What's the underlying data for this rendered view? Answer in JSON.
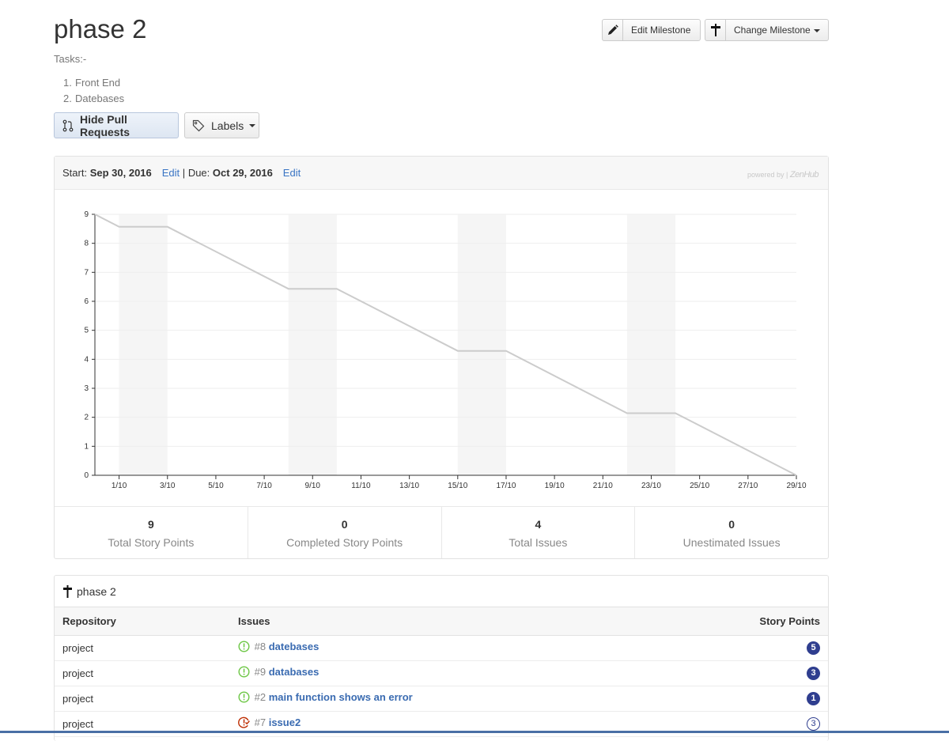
{
  "milestone": {
    "title": "phase 2",
    "tasks_label": "Tasks:-",
    "tasks": [
      {
        "num": "1.",
        "text": "Front End"
      },
      {
        "num": "2.",
        "text": "Datebases"
      }
    ]
  },
  "toolbar": {
    "edit_milestone": "Edit Milestone",
    "change_milestone": "Change Milestone",
    "hide_pull_requests": "Hide Pull Requests",
    "labels": "Labels"
  },
  "burndown": {
    "start_label": "Start:",
    "start_date": "Sep 30, 2016",
    "edit_start": "Edit",
    "separator": "|",
    "due_label": "Due:",
    "due_date": "Oct 29, 2016",
    "edit_due": "Edit",
    "powered_by": "powered by |",
    "powered_brand": "ZenHub"
  },
  "chart_data": {
    "type": "line",
    "x_start": "2016-09-30",
    "x_end": "2016-10-29",
    "x_tick_labels": [
      "1/10",
      "3/10",
      "5/10",
      "7/10",
      "9/10",
      "11/10",
      "13/10",
      "15/10",
      "17/10",
      "19/10",
      "21/10",
      "23/10",
      "25/10",
      "27/10",
      "29/10"
    ],
    "ylim": [
      0,
      9
    ],
    "y_ticks": [
      0,
      1,
      2,
      3,
      4,
      5,
      6,
      7,
      8,
      9
    ],
    "grid": true,
    "weekend_shading": [
      [
        "2016-10-01",
        "2016-10-03"
      ],
      [
        "2016-10-08",
        "2016-10-10"
      ],
      [
        "2016-10-15",
        "2016-10-17"
      ],
      [
        "2016-10-22",
        "2016-10-24"
      ],
      [
        "2016-10-29",
        "2016-10-30"
      ]
    ],
    "series": [
      {
        "color": "#cccccc",
        "points": [
          {
            "x": "2016-09-30",
            "y": 9
          },
          {
            "x": "2016-10-01",
            "y": 8.57
          },
          {
            "x": "2016-10-03",
            "y": 8.57
          },
          {
            "x": "2016-10-08",
            "y": 6.43
          },
          {
            "x": "2016-10-10",
            "y": 6.43
          },
          {
            "x": "2016-10-15",
            "y": 4.29
          },
          {
            "x": "2016-10-17",
            "y": 4.29
          },
          {
            "x": "2016-10-22",
            "y": 2.14
          },
          {
            "x": "2016-10-24",
            "y": 2.14
          },
          {
            "x": "2016-10-29",
            "y": 0
          }
        ]
      }
    ]
  },
  "stats": [
    {
      "value": "9",
      "label": "Total Story Points"
    },
    {
      "value": "0",
      "label": "Completed Story Points"
    },
    {
      "value": "4",
      "label": "Total Issues"
    },
    {
      "value": "0",
      "label": "Unestimated Issues"
    }
  ],
  "issues": {
    "heading": "phase 2",
    "columns": {
      "repository": "Repository",
      "issues": "Issues",
      "story_points": "Story Points"
    },
    "rows": [
      {
        "repo": "project",
        "state": "open",
        "number": "#8",
        "title": "datebases",
        "points": "5",
        "estimate_style": "filled"
      },
      {
        "repo": "project",
        "state": "open",
        "number": "#9",
        "title": "databases",
        "points": "3",
        "estimate_style": "filled"
      },
      {
        "repo": "project",
        "state": "open",
        "number": "#2",
        "title": "main function shows an error",
        "points": "1",
        "estimate_style": "filled"
      },
      {
        "repo": "project",
        "state": "closed",
        "number": "#7",
        "title": "issue2",
        "points": "3",
        "estimate_style": "outline"
      }
    ]
  },
  "colors": {
    "link": "#3a75c4",
    "issue_open": "#6cc644",
    "issue_closed": "#bd2c00",
    "badge": "#2f3e8f",
    "burndown_line": "#cccccc"
  }
}
